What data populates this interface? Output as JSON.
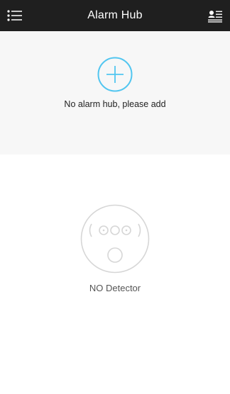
{
  "header": {
    "title": "Alarm Hub",
    "menu_icon": "menu-icon",
    "account_icon": "account-list-icon",
    "background": "#1f1f1f"
  },
  "hub_panel": {
    "add_icon": "add-circle-icon",
    "message": "No alarm hub, please add",
    "accent_color": "#52c6f0",
    "background": "#f7f7f7"
  },
  "detector": {
    "icon": "detector-icon",
    "label": "NO Detector"
  }
}
